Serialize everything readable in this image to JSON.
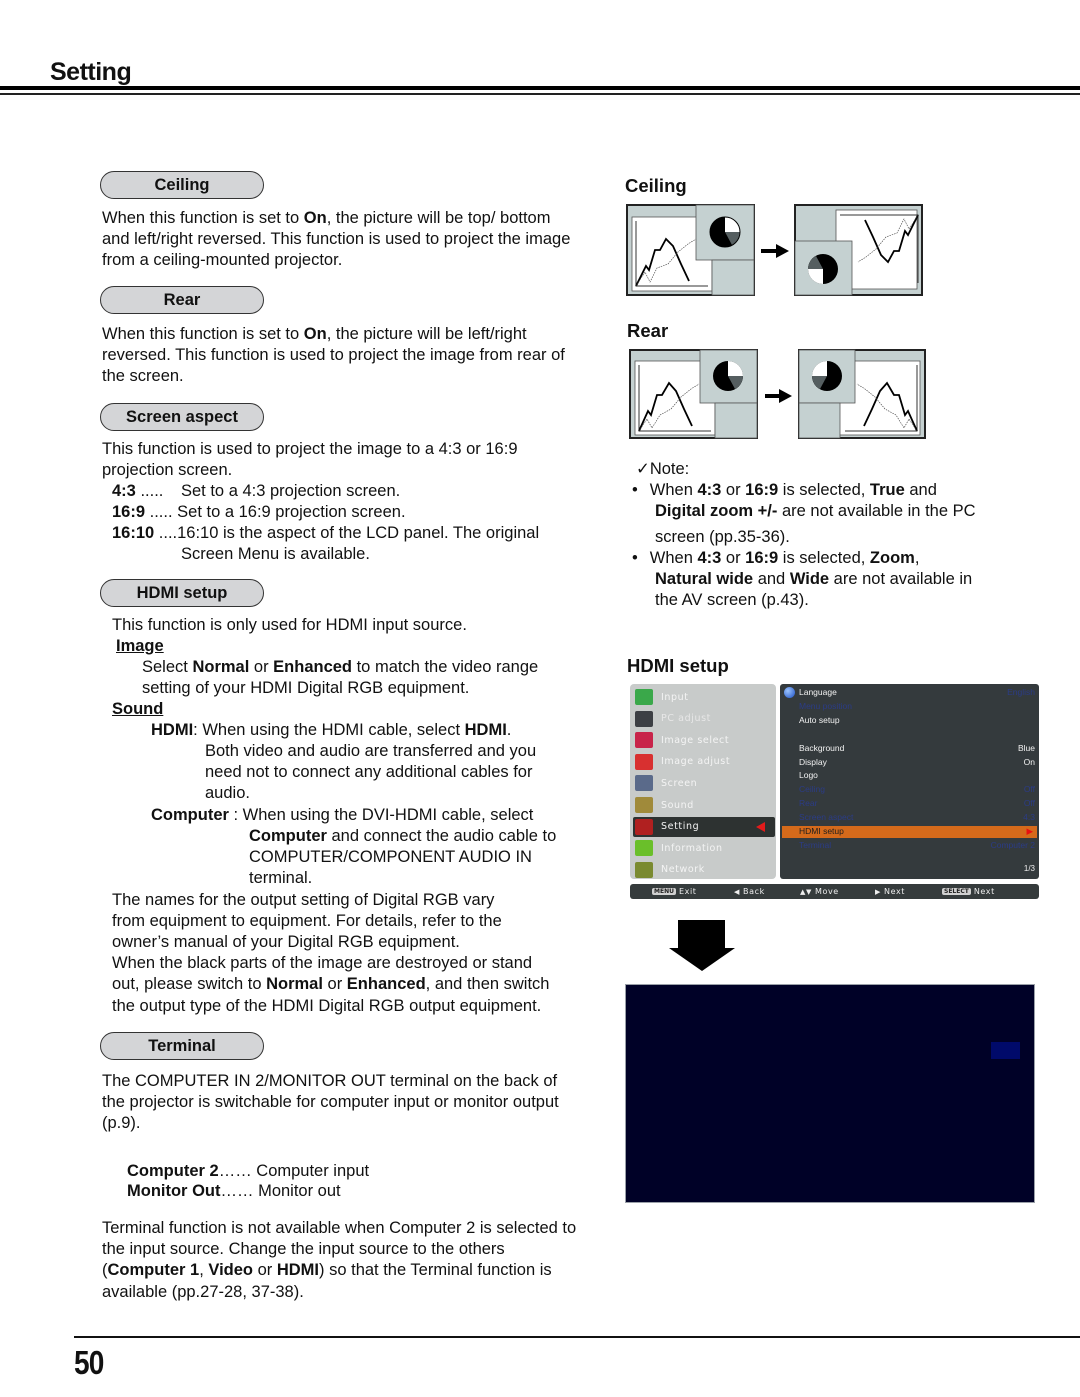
{
  "header": {
    "title": "Setting"
  },
  "left": {
    "ceiling": {
      "heading": "Ceiling",
      "text_pre": "When this function is set to ",
      "text_bold": "On",
      "text_post": ", the picture will be top/ bottom and left/right reversed. This function is used to project the image from a ceiling-mounted projector."
    },
    "rear": {
      "heading": "Rear",
      "text_pre": "When this function is set to ",
      "text_bold": "On",
      "text_post": ", the picture will be left/right reversed. This function is used to project the image from rear of the screen."
    },
    "screen_aspect": {
      "heading": "Screen aspect",
      "intro": "This function is used to project the image to a 4:3 or 16:9 projection screen.",
      "options": [
        {
          "key": "4:3",
          "dots": " .....",
          "desc": "Set to a 4:3 projection screen."
        },
        {
          "key": "16:9",
          "dots": " .....",
          "desc": "Set to a 16:9 projection screen."
        },
        {
          "key": "16:10",
          "dots": " ....",
          "desc": "16:10 is the aspect of the LCD panel. The original",
          "desc2": "Screen Menu is available."
        }
      ]
    },
    "hdmi_setup": {
      "heading": "HDMI setup",
      "intro": "This function is only used for HDMI input source.",
      "image_label": " Image",
      "image_text": [
        "Select ",
        "Normal",
        " or ",
        "Enhanced",
        " to match the video range"
      ],
      "image_text2": "setting of your HDMI Digital RGB equipment.",
      "sound_label": " Sound",
      "hdmi_key": "HDMI",
      "hdmi_line1_a": ": When using the HDMI cable, select ",
      "hdmi_line1_b": "HDMI",
      "hdmi_line1_c": ".",
      "hdmi_lines": [
        "Both video and audio are transferred and you",
        "need not to connect any additional cables for",
        "audio."
      ],
      "computer_key": "Computer",
      "computer_line1": " : When using the DVI-HDMI cable, select",
      "computer_line2_bold": "Computer",
      "computer_line2": " and connect the audio cable to",
      "computer_lines": [
        "COMPUTER/COMPONENT AUDIO IN",
        "terminal."
      ],
      "names_text": [
        "The names for the output setting of Digital RGB vary",
        "from equipment to equipment. For details, refer to the",
        "owner’s manual of your Digital RGB equipment."
      ],
      "black_line1": "When the black parts of the image are destroyed or stand",
      "black_line2": [
        "out, please switch to ",
        "Normal",
        " or ",
        "Enhanced",
        ", and then switch"
      ],
      "black_line3": "the output type of the HDMI Digital RGB output equipment."
    },
    "terminal": {
      "heading": "Terminal",
      "intro": "The COMPUTER IN 2/MONITOR OUT terminal on the back of the projector is switchable for computer input or monitor output (p.9).",
      "options": [
        {
          "key": "Computer 2",
          "dots": "……",
          "desc": " Computer input"
        },
        {
          "key": "Monitor Out",
          "dots": "……",
          "desc": " Monitor out"
        }
      ],
      "note": [
        "Terminal function is not available when Computer 2 is selected to the input source. Change the input source to the others (",
        "Computer 1",
        ", ",
        "Video",
        " or ",
        "HDMI",
        ") so that the Terminal function is  available (pp.27-28, 37-38)."
      ]
    }
  },
  "right": {
    "ceiling_title": "Ceiling",
    "rear_title": "Rear",
    "note": {
      "title": "✓Note:",
      "bullets": [
        {
          "parts": [
            "When ",
            "4:3",
            " or ",
            "16:9",
            " is selected, ",
            "True",
            " and"
          ],
          "line2": [
            "Digital zoom +/-",
            " are not available in the PC"
          ],
          "line3": "screen (pp.35-36)."
        },
        {
          "parts": [
            "When ",
            "4:3",
            " or ",
            "16:9",
            " is selected, ",
            "Zoom",
            ","
          ],
          "line2": [
            "Natural wide",
            " and ",
            "Wide",
            " are not available in"
          ],
          "line3": "the  AV screen (p.43)."
        }
      ]
    },
    "hdmi_title": "HDMI setup",
    "osd": {
      "menu": [
        {
          "label": "Input",
          "icon": "input-icon",
          "color": "#3aa84a"
        },
        {
          "label": "PC adjust",
          "icon": "pc-adjust-icon",
          "color": "#3c3f44"
        },
        {
          "label": "Image select",
          "icon": "image-select-icon",
          "color": "#c8244a"
        },
        {
          "label": "Image adjust",
          "icon": "image-adjust-icon",
          "color": "#d83030"
        },
        {
          "label": "Screen",
          "icon": "screen-icon",
          "color": "#5a6a8a"
        },
        {
          "label": "Sound",
          "icon": "sound-icon",
          "color": "#a08a3a"
        },
        {
          "label": "Setting",
          "icon": "wrench-icon",
          "color": "#b02020"
        },
        {
          "label": "Information",
          "icon": "info-icon",
          "color": "#6abf2a"
        },
        {
          "label": "Network",
          "icon": "network-icon",
          "color": "#7a8a30"
        }
      ],
      "selected": "Setting",
      "settings": [
        {
          "label": "Language",
          "value": "English",
          "style": "white",
          "value_style": "blue"
        },
        {
          "label": "Menu position",
          "value": "",
          "style": "blue"
        },
        {
          "label": "Auto setup",
          "value": "",
          "style": "white"
        },
        {
          "label": "",
          "value": "",
          "style": "white"
        },
        {
          "label": "Background",
          "value": "Blue",
          "style": "white"
        },
        {
          "label": "Display",
          "value": "On",
          "style": "white"
        },
        {
          "label": "Logo",
          "value": "",
          "style": "white"
        },
        {
          "label": "Ceiling",
          "value": "Off",
          "style": "blue"
        },
        {
          "label": "Rear",
          "value": "Off",
          "style": "blue"
        },
        {
          "label": "Screen aspect",
          "value": "4:3",
          "style": "blue"
        },
        {
          "label": "HDMI setup",
          "value": "▶",
          "style": "hl"
        },
        {
          "label": "Terminal",
          "value": "Computer 2",
          "style": "blue"
        }
      ],
      "page": "1/3",
      "bar": [
        {
          "key": "MENU",
          "label": "Exit"
        },
        {
          "key": "◀",
          "label": "Back"
        },
        {
          "key": "▲▼",
          "label": "Move"
        },
        {
          "key": "▶",
          "label": "Next"
        },
        {
          "key": "SELECT",
          "label": "Next"
        }
      ]
    }
  },
  "footer": {
    "page_number": "50"
  }
}
